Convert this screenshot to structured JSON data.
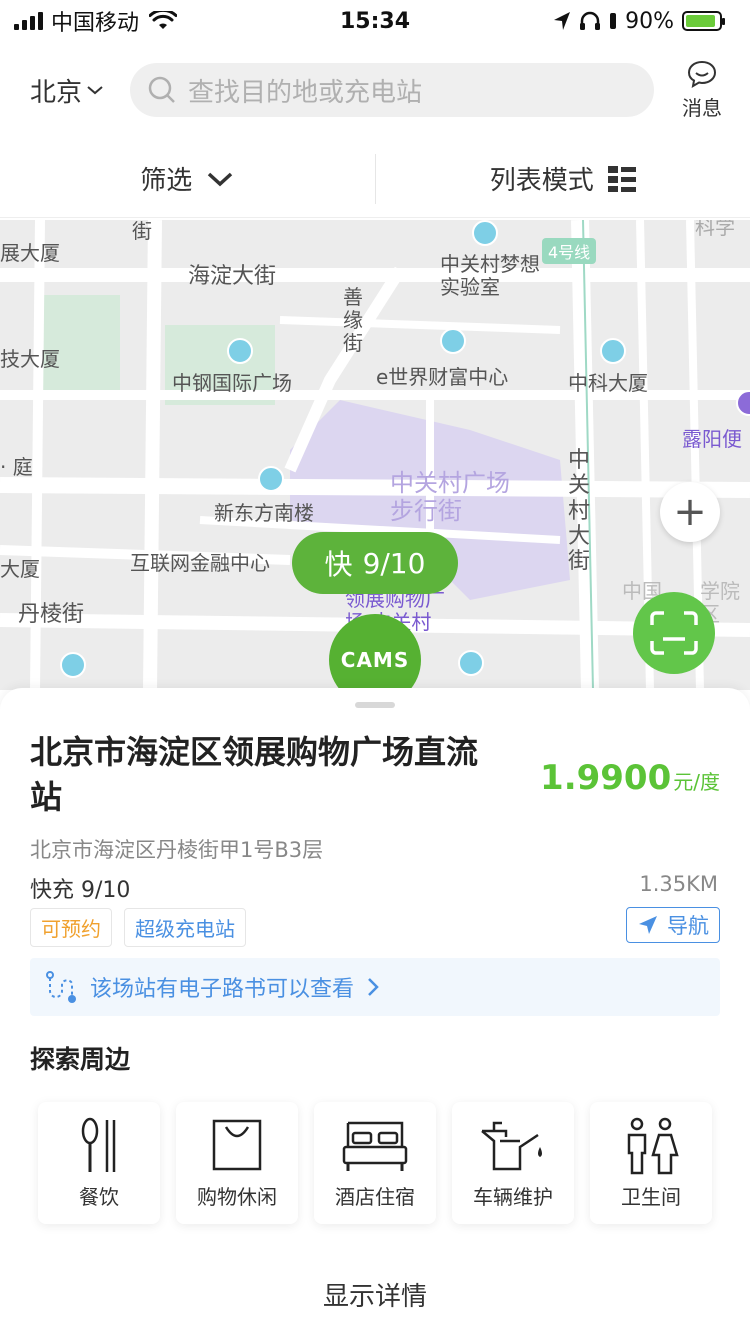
{
  "status_bar": {
    "carrier": "中国移动",
    "time": "15:34",
    "battery_percent": "90%",
    "battery_level": 0.9
  },
  "header": {
    "city": "北京",
    "search_placeholder": "查找目的地或充电站",
    "message_label": "消息"
  },
  "filter_bar": {
    "filter_label": "筛选",
    "mode_label": "列表模式"
  },
  "map": {
    "labels": {
      "jie": "街",
      "zhan_dasha": "展大厦",
      "haidian_dajie": "海淀大街",
      "shanyuan_jie": "善缘街",
      "zhongguancun_lab": "中关村梦想实验室",
      "metro_line": "4号线",
      "kexue": "科学",
      "ji_dasha": "技大厦",
      "zhonggang_guoji": "中钢国际广场",
      "e_shijie": "e世界财富中心",
      "zhongke_dasha": "中科大厦",
      "luyang": "露阳便",
      "ting": "· 庭",
      "zhongguancun_guangchang": "中关村广场步行街",
      "zhongguancun_dajie": "中关村大街",
      "xindongfang": "新东方南楼",
      "hulianwang": "互联网金融中心",
      "da_sha": "大厦",
      "danleng_jie": "丹棱街",
      "lingzhan_map": "领展购物广场·中关村",
      "xueyuan_right": "学院区",
      "zhong_right": "中国"
    },
    "marker": {
      "type_label": "快",
      "count": "9/10",
      "logo_text": "CAMS"
    },
    "zoom_in": "+"
  },
  "station": {
    "name": "北京市海淀区领展购物广场直流站",
    "price_value": "1.9900",
    "price_unit": "元/度",
    "address": "北京市海淀区丹棱街甲1号B3层",
    "charge_info": "快充 9/10",
    "distance": "1.35KM",
    "tags": [
      "可预约",
      "超级充电站"
    ],
    "nav_label": "导航",
    "roadbook_text": "该场站有电子路书可以查看"
  },
  "explore": {
    "title": "探索周边",
    "categories": [
      {
        "label": "餐饮",
        "icon": "utensils-icon"
      },
      {
        "label": "购物休闲",
        "icon": "shopping-bag-icon"
      },
      {
        "label": "酒店住宿",
        "icon": "bed-icon"
      },
      {
        "label": "车辆维护",
        "icon": "oil-can-icon"
      },
      {
        "label": "卫生间",
        "icon": "restroom-icon"
      }
    ]
  },
  "details_label": "显示详情",
  "colors": {
    "accent_green": "#5bc337",
    "link_blue": "#4a90e2",
    "reserve_orange": "#f0a12e"
  }
}
